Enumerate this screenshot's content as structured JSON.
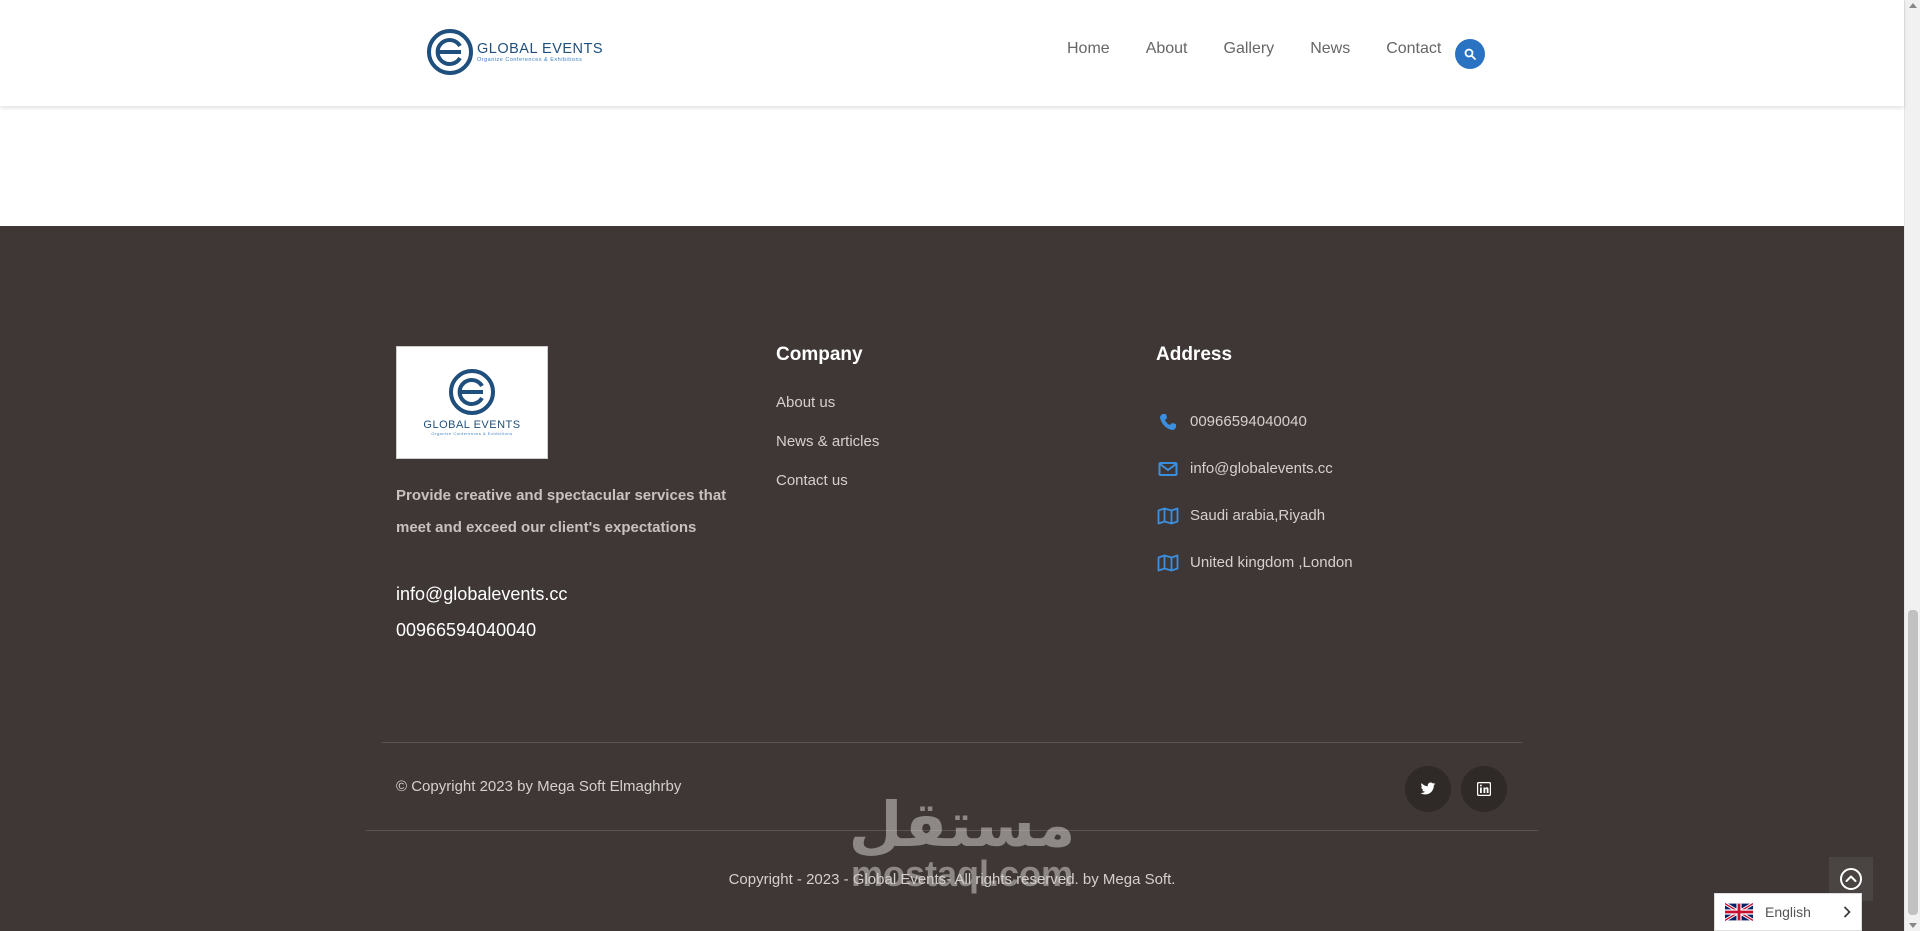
{
  "header": {
    "logo": {
      "name": "GLOBAL EVENTS",
      "tagline": "Organize Conferences & Exhibitions"
    },
    "nav": [
      {
        "label": "Home"
      },
      {
        "label": "About"
      },
      {
        "label": "Gallery"
      },
      {
        "label": "News"
      },
      {
        "label": "Contact"
      }
    ],
    "search_icon": "search-icon"
  },
  "footer": {
    "logo": {
      "name": "GLOBAL EVENTS",
      "tagline": "Organize Conferences & Exhibitions"
    },
    "description": "Provide creative and spectacular services that meet and exceed our client's expectations",
    "email": "info@globalevents.cc",
    "phone": "00966594040040",
    "company": {
      "title": "Company",
      "links": [
        {
          "label": "About us"
        },
        {
          "label": "News & articles"
        },
        {
          "label": "Contact us"
        }
      ]
    },
    "address": {
      "title": "Address",
      "items": [
        {
          "icon": "phone-icon",
          "text": "00966594040040"
        },
        {
          "icon": "envelope-icon",
          "text": "info@globalevents.cc"
        },
        {
          "icon": "map-icon",
          "text": "Saudi arabia,Riyadh"
        },
        {
          "icon": "map-icon",
          "text": "United kingdom ,London"
        }
      ]
    },
    "copyright": "© Copyright 2023 by Mega Soft Elmaghrby",
    "social": [
      {
        "icon": "twitter-icon"
      },
      {
        "icon": "linkedin-icon"
      }
    ],
    "bottom_copyright": "Copyright - 2023 - Global Events- All rights reserved. by Mega Soft."
  },
  "watermark": {
    "arabic": "مستقل",
    "latin": "mostaql.com"
  },
  "language": {
    "label": "English",
    "flag": "uk-flag-icon"
  },
  "colors": {
    "accent": "#2a73c2",
    "footer_bg": "#3e3735",
    "icon_blue": "#3b8fe0"
  }
}
